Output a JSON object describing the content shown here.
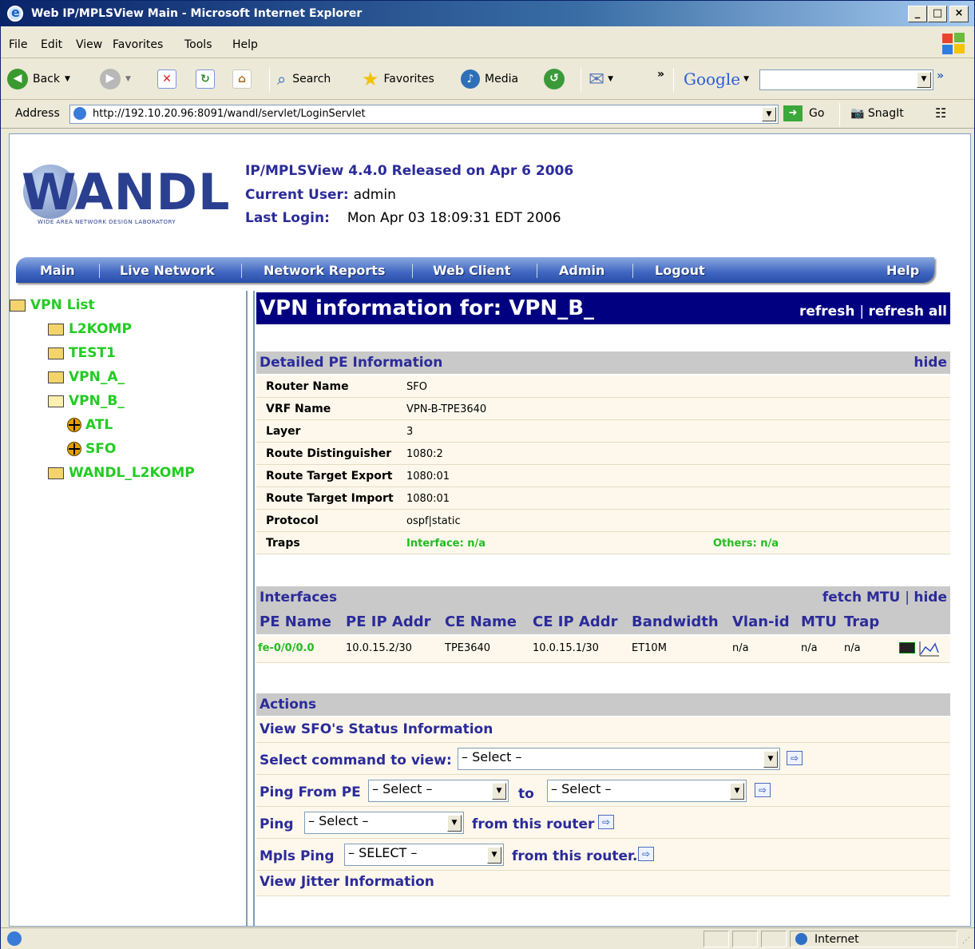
{
  "window": {
    "title": "Web IP/MPLSView Main - Microsoft Internet Explorer"
  },
  "menu": [
    "File",
    "Edit",
    "View",
    "Favorites",
    "Tools",
    "Help"
  ],
  "toolbar": {
    "back": "Back",
    "search": "Search",
    "favorites": "Favorites",
    "media": "Media",
    "google": "Google"
  },
  "address": {
    "label": "Address",
    "url": "http://192.10.20.96:8091/wandl/servlet/LoginServlet",
    "go": "Go",
    "snagit": "SnagIt"
  },
  "header": {
    "logo_text": "WANDL",
    "logo_sub": "WIDE AREA NETWORK DESIGN LABORATORY",
    "release": "IP/MPLSView 4.4.0 Released on Apr 6 2006",
    "current_user_label": "Current User:",
    "current_user": "admin",
    "last_login_label": "Last Login:",
    "last_login": "Mon Apr 03 18:09:31 EDT 2006"
  },
  "nav": [
    "Main",
    "Live Network",
    "Network Reports",
    "Web Client",
    "Admin",
    "Logout",
    "Help"
  ],
  "tree": {
    "root": "VPN List",
    "items": [
      "L2KOMP",
      "TEST1",
      "VPN_A_",
      "VPN_B_",
      "WANDL_L2KOMP"
    ],
    "children": [
      "ATL",
      "SFO"
    ]
  },
  "main": {
    "title": "VPN information for: VPN_B_",
    "refresh": "refresh",
    "refresh_all": "refresh all",
    "pe_section": "Detailed PE Information",
    "hide": "hide",
    "details": [
      {
        "k": "Router Name",
        "v": "SFO"
      },
      {
        "k": "VRF Name",
        "v": "VPN-B-TPE3640"
      },
      {
        "k": "Layer",
        "v": "3"
      },
      {
        "k": "Route Distinguisher",
        "v": "1080:2"
      },
      {
        "k": "Route Target Export",
        "v": "1080:01"
      },
      {
        "k": "Route Target Import",
        "v": "1080:01"
      },
      {
        "k": "Protocol",
        "v": "ospf|static"
      }
    ],
    "traps_label": "Traps",
    "traps_interface": "Interface: n/a",
    "traps_others": "Others: n/a",
    "interfaces_section": "Interfaces",
    "fetch_mtu": "fetch MTU",
    "interface_headers": [
      "PE Name",
      "PE IP Addr",
      "CE Name",
      "CE IP Addr",
      "Bandwidth",
      "Vlan-id",
      "MTU",
      "Trap"
    ],
    "interface_row": [
      "fe-0/0/0.0",
      "10.0.15.2/30",
      "TPE3640",
      "10.0.15.1/30",
      "ET10M",
      "n/a",
      "n/a",
      "n/a"
    ],
    "actions_section": "Actions",
    "view_status": "View SFO's Status Information",
    "select_cmd_label": "Select command to view:",
    "select_placeholder": "– Select –",
    "ping_from_label": "Ping From PE",
    "to_label": "to",
    "ping_label": "Ping",
    "from_router": "from this router",
    "mpls_ping_label": "Mpls Ping",
    "mpls_select": "– SELECT –",
    "from_router_dot": "from this router.",
    "view_jitter": "View Jitter Information"
  },
  "status": {
    "zone": "Internet"
  }
}
